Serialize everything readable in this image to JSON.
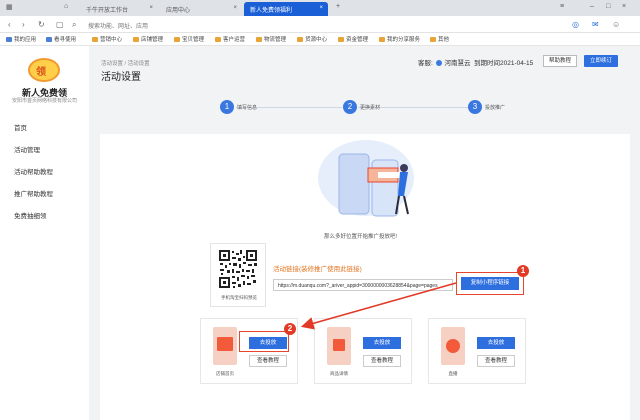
{
  "browser": {
    "tabs": [
      {
        "label": "千牛开放工作台"
      },
      {
        "label": "应用中心"
      },
      {
        "label": "新人免费领福利"
      }
    ],
    "address_placeholder": "搜索功能、网址、应用",
    "bookmarks": [
      "我的应用",
      "看寻使用",
      "营销中心",
      "店铺管理",
      "宝贝管理",
      "客户运营",
      "物流管理",
      "货源中心",
      "资金管理",
      "我的分享服务",
      "其他"
    ]
  },
  "sidebar": {
    "logo_text": "领",
    "store_name": "新人免费领",
    "company": "安阳市首页网络科技有限公司",
    "items": [
      {
        "label": "首页"
      },
      {
        "label": "活动管理"
      },
      {
        "label": "活动帮助教程"
      },
      {
        "label": "推广帮助教程"
      },
      {
        "label": "免费抽细领"
      }
    ]
  },
  "header": {
    "breadcrumb": "活动设置  /  活动设置",
    "title": "活动设置",
    "support_label": "客服:",
    "support_name": "河南慧云",
    "expiry": "到期时间2021-04-15",
    "help_button": "帮助教程",
    "renew_button": "立即续订"
  },
  "steps": [
    {
      "num": "1",
      "label": "填写信息"
    },
    {
      "num": "2",
      "label": "更换素材"
    },
    {
      "num": "3",
      "label": "投放推广"
    }
  ],
  "main": {
    "illustration_hint": "那么多好位置开始推广投放吧!",
    "qr_caption": "手机淘宝扫码预览",
    "link_label": "活动链接(装修推广使用此链接)",
    "link_value": "https://m.duanqu.com?_ariver_appid=3000000003628854&page=pages",
    "copy_button": "复制小程序链接",
    "cards": [
      {
        "name": "店铺首页",
        "promo": "去投放",
        "tutorial": "查看教程"
      },
      {
        "name": "商品详情",
        "promo": "去投放",
        "tutorial": "查看教程"
      },
      {
        "name": "直播",
        "promo": "去投放",
        "tutorial": "查看教程"
      }
    ]
  },
  "annotations": {
    "badge_1": "1",
    "badge_2": "2"
  },
  "colors": {
    "accent": "#2e6fe0",
    "annotation_red": "#e23a26",
    "link_orange": "#e0721e"
  }
}
